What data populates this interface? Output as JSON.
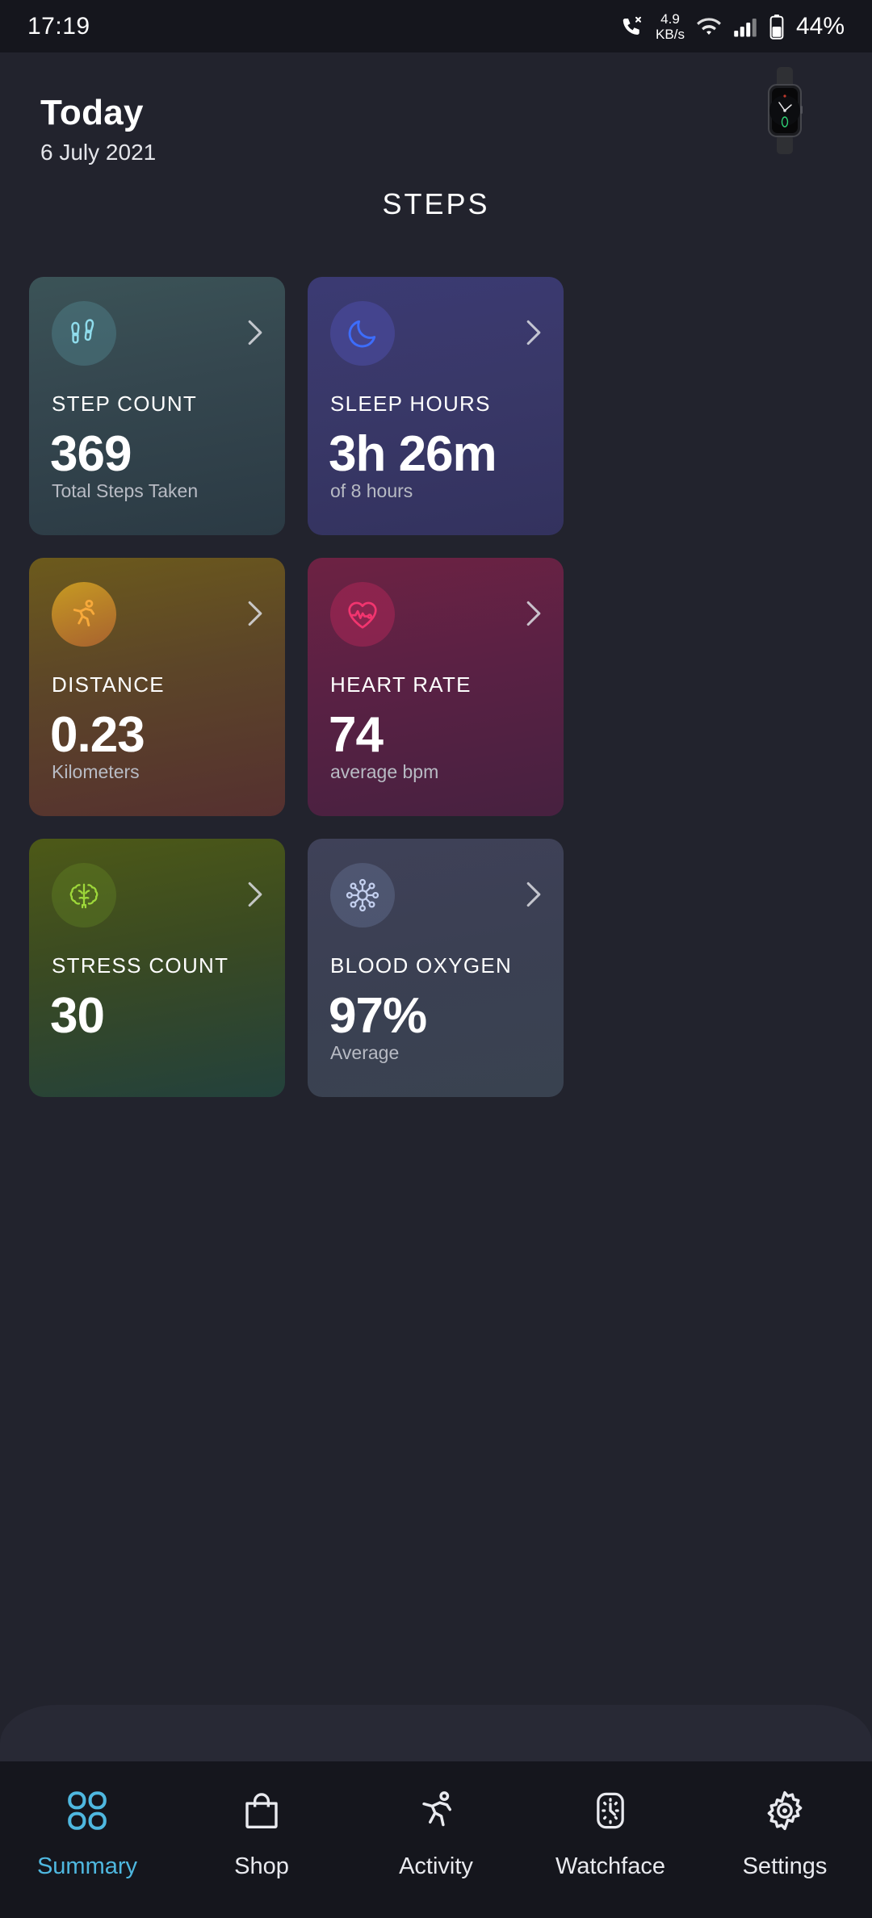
{
  "status_bar": {
    "time": "17:19",
    "net_speed_value": "4.9",
    "net_speed_unit": "KB/s",
    "battery": "44%",
    "icons": [
      "phone-call-icon",
      "wifi-icon",
      "cellular-signal-icon",
      "battery-icon"
    ]
  },
  "header": {
    "title": "Today",
    "date": "6 July 2021",
    "device_icon": "smartwatch-icon"
  },
  "section": {
    "title": "STEPS"
  },
  "cards": [
    {
      "icon": "footprints-icon",
      "label": "STEP COUNT",
      "value": "369",
      "sub": "Total Steps Taken",
      "accent": "#7fd6e6"
    },
    {
      "icon": "moon-icon",
      "label": "SLEEP HOURS",
      "value": "3h 26m",
      "sub": "of 8 hours",
      "accent": "#3d6dfb"
    },
    {
      "icon": "running-person-icon",
      "label": "DISTANCE",
      "value": "0.23",
      "sub": "Kilometers",
      "accent": "#f7b733"
    },
    {
      "icon": "heart-pulse-icon",
      "label": "HEART RATE",
      "value": "74",
      "sub": "average bpm",
      "accent": "#f2356f"
    },
    {
      "icon": "brain-icon",
      "label": "STRESS COUNT",
      "value": "30",
      "sub": "",
      "accent": "#9ed83a"
    },
    {
      "icon": "molecule-icon",
      "label": "BLOOD OXYGEN",
      "value": "97%",
      "sub": "Average",
      "accent": "#b9c6e8"
    }
  ],
  "bottom_nav": {
    "active_index": 0,
    "active_color": "#4fb8e0",
    "items": [
      {
        "label": "Summary",
        "icon": "grid-squares-icon"
      },
      {
        "label": "Shop",
        "icon": "shopping-bag-icon"
      },
      {
        "label": "Activity",
        "icon": "running-person-icon"
      },
      {
        "label": "Watchface",
        "icon": "watchface-clock-icon"
      },
      {
        "label": "Settings",
        "icon": "gear-icon"
      }
    ]
  }
}
